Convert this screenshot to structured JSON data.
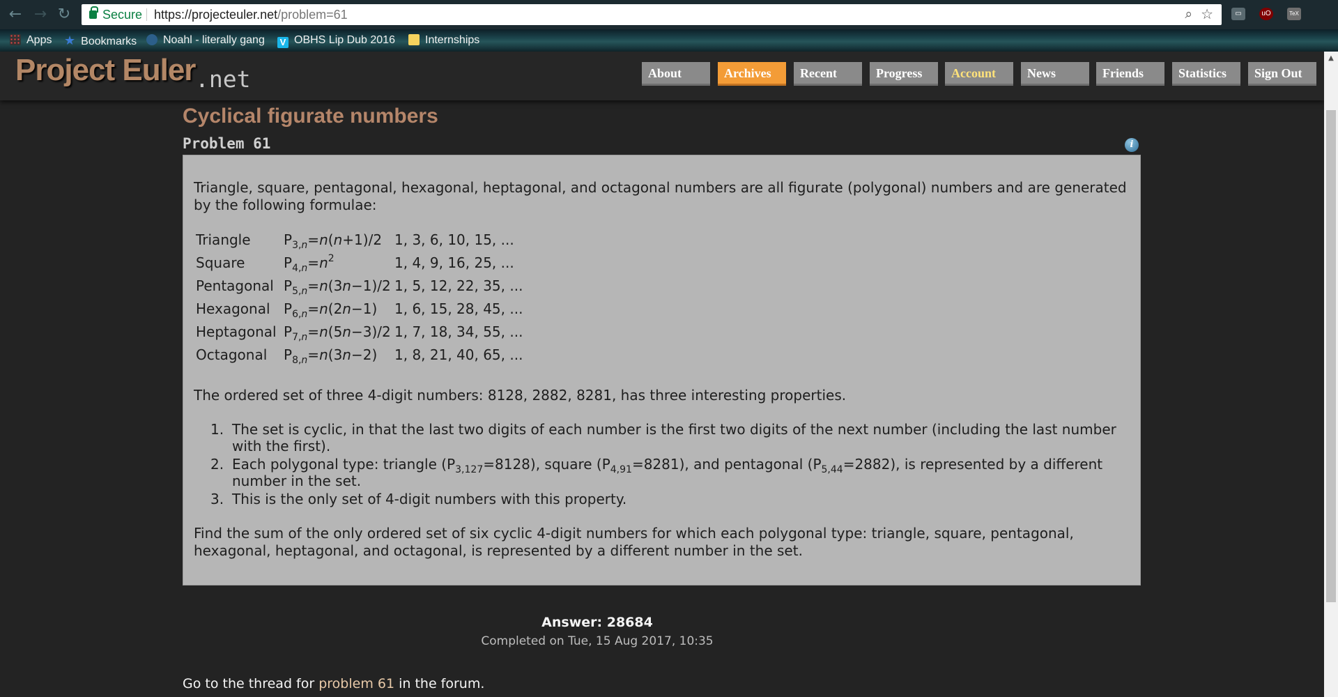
{
  "browser": {
    "nav": {
      "back": "←",
      "forward": "→",
      "reload": "↻"
    },
    "secure_label": "Secure",
    "url_host": "https://projecteuler.net",
    "url_path": "/problem=61",
    "extensions": [
      {
        "name": "cast-icon",
        "glyph": "▭",
        "color": "#5a6a70"
      },
      {
        "name": "ublock-icon",
        "glyph": "uO",
        "color": "#800000"
      },
      {
        "name": "tex-icon",
        "glyph": "TeX",
        "color": "#6e6e6e"
      }
    ],
    "bookmarks": [
      {
        "label": "Apps",
        "icon": "apps-grid-icon"
      },
      {
        "label": "Bookmarks",
        "icon": "star-icon"
      },
      {
        "label": "Noahl - literally gang",
        "icon": "play-icon"
      },
      {
        "label": "OBHS Lip Dub 2016",
        "icon": "vimeo-icon"
      },
      {
        "label": "Internships",
        "icon": "folder-icon"
      }
    ]
  },
  "site": {
    "logo_main": "Project Euler",
    "logo_net": ".net",
    "nav": [
      {
        "label": "About"
      },
      {
        "label": "Archives"
      },
      {
        "label": "Recent"
      },
      {
        "label": "Progress"
      },
      {
        "label": "Account"
      },
      {
        "label": "News"
      },
      {
        "label": "Friends"
      },
      {
        "label": "Statistics"
      },
      {
        "label": "Sign Out"
      }
    ],
    "active_nav": "Archives",
    "accent_color": "#f39c37"
  },
  "problem": {
    "title": "Cyclical figurate numbers",
    "number": "Problem 61",
    "intro": "Triangle, square, pentagonal, hexagonal, heptagonal, and octagonal numbers are all figurate (polygonal) numbers and are generated by the following formulae:",
    "formulas": [
      {
        "name": "Triangle",
        "P": "P",
        "sub": "3,",
        "var": "n",
        "formula": "=n(n+1)/2",
        "sup": "",
        "sequence": "1, 3, 6, 10, 15, ..."
      },
      {
        "name": "Square",
        "P": "P",
        "sub": "4,",
        "var": "n",
        "formula": "=n",
        "sup": "2",
        "sequence": "1, 4, 9, 16, 25, ..."
      },
      {
        "name": "Pentagonal",
        "P": "P",
        "sub": "5,",
        "var": "n",
        "formula": "=n(3n−1)/2",
        "sup": "",
        "sequence": "1, 5, 12, 22, 35, ..."
      },
      {
        "name": "Hexagonal",
        "P": "P",
        "sub": "6,",
        "var": "n",
        "formula": "=n(2n−1)",
        "sup": "",
        "sequence": "1, 6, 15, 28, 45, ..."
      },
      {
        "name": "Heptagonal",
        "P": "P",
        "sub": "7,",
        "var": "n",
        "formula": "=n(5n−3)/2",
        "sup": "",
        "sequence": "1, 7, 18, 34, 55, ..."
      },
      {
        "name": "Octagonal",
        "P": "P",
        "sub": "8,",
        "var": "n",
        "formula": "=n(3n−2)",
        "sup": "",
        "sequence": "1, 8, 21, 40, 65, ..."
      }
    ],
    "ordered_set_text": "The ordered set of three 4-digit numbers: 8128, 2882, 8281, has three interesting properties.",
    "properties": {
      "p1_num": "1.",
      "p1": "The set is cyclic, in that the last two digits of each number is the first two digits of the next number (including the last number with the first).",
      "p2_num": "2.",
      "p2_a": "Each polygonal type: triangle (P",
      "p2_sub1": "3,127",
      "p2_b": "=8128), square (P",
      "p2_sub2": "4,91",
      "p2_c": "=8281), and pentagonal (P",
      "p2_sub3": "5,44",
      "p2_d": "=2882), is represented by a different number in the set.",
      "p3_num": "3.",
      "p3": "This is the only set of 4-digit numbers with this property."
    },
    "question": "Find the sum of the only ordered set of six cyclic 4-digit numbers for which each polygonal type: triangle, square, pentagonal, hexagonal, heptagonal, and octagonal, is represented by a different number in the set."
  },
  "answer": {
    "label": "Answer: ",
    "value": "28684",
    "completed": "Completed on Tue, 15 Aug 2017, 10:35"
  },
  "forum": {
    "prefix": "Go to the thread for ",
    "link": "problem 61",
    "suffix": " in the forum."
  }
}
